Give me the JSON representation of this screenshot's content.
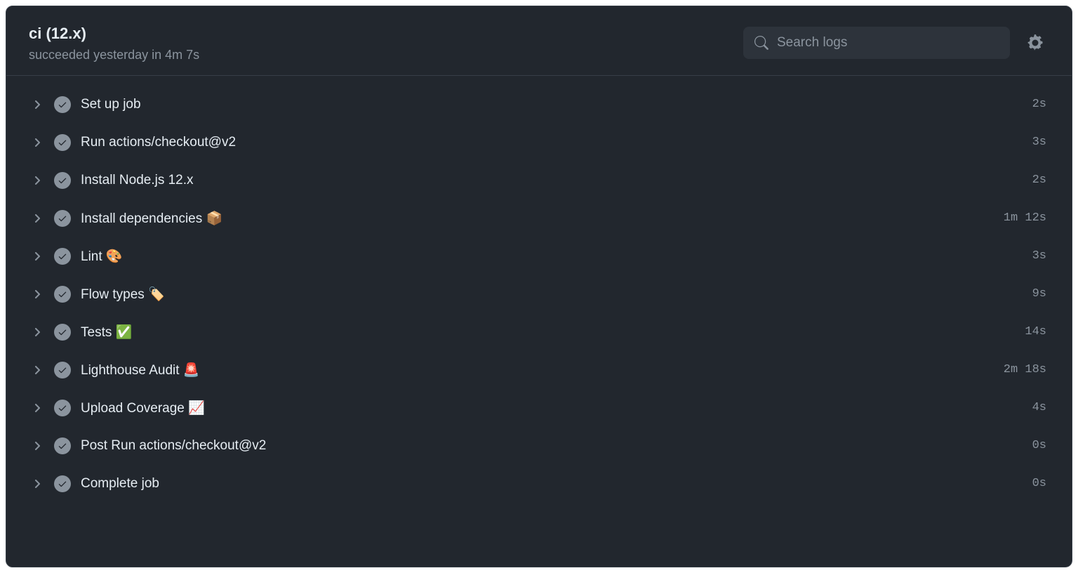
{
  "header": {
    "title": "ci (12.x)",
    "subtitle": "succeeded yesterday in 4m 7s"
  },
  "search": {
    "placeholder": "Search logs"
  },
  "steps": [
    {
      "label": "Set up job",
      "duration": "2s"
    },
    {
      "label": "Run actions/checkout@v2",
      "duration": "3s"
    },
    {
      "label": "Install Node.js 12.x",
      "duration": "2s"
    },
    {
      "label": "Install dependencies 📦",
      "duration": "1m 12s"
    },
    {
      "label": "Lint 🎨",
      "duration": "3s"
    },
    {
      "label": "Flow types 🏷️",
      "duration": "9s"
    },
    {
      "label": "Tests ✅",
      "duration": "14s"
    },
    {
      "label": "Lighthouse Audit 🚨",
      "duration": "2m 18s"
    },
    {
      "label": "Upload Coverage 📈",
      "duration": "4s"
    },
    {
      "label": "Post Run actions/checkout@v2",
      "duration": "0s"
    },
    {
      "label": "Complete job",
      "duration": "0s"
    }
  ]
}
